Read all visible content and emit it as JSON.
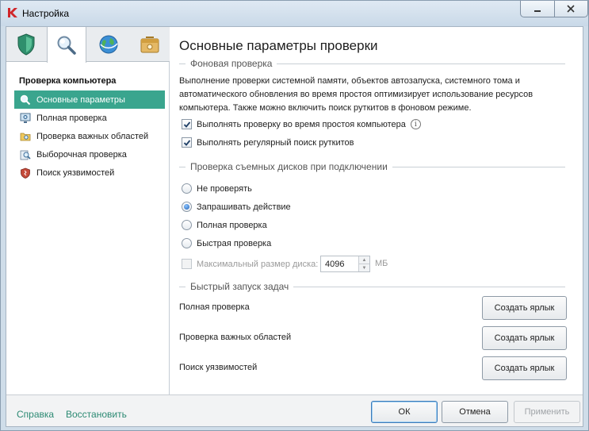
{
  "window": {
    "title": "Настройка",
    "minimize_icon": "minimize-icon",
    "close_icon": "close-icon"
  },
  "tabs": [
    {
      "name": "protection",
      "icon": "shield-icon"
    },
    {
      "name": "scan",
      "icon": "magnifier-icon"
    },
    {
      "name": "update",
      "icon": "globe-icon"
    },
    {
      "name": "advanced",
      "icon": "safe-box-icon"
    }
  ],
  "sidebar": {
    "section_title": "Проверка компьютера",
    "items": [
      {
        "label": "Основные параметры",
        "icon": "magnifier-icon",
        "selected": true
      },
      {
        "label": "Полная проверка",
        "icon": "monitor-scan-icon",
        "selected": false
      },
      {
        "label": "Проверка важных областей",
        "icon": "folder-scan-icon",
        "selected": false
      },
      {
        "label": "Выборочная проверка",
        "icon": "custom-scan-icon",
        "selected": false
      },
      {
        "label": "Поиск уязвимостей",
        "icon": "vulnerability-shield-icon",
        "selected": false
      }
    ]
  },
  "main": {
    "title": "Основные параметры проверки",
    "background_scan": {
      "group_title": "Фоновая проверка",
      "description": "Выполнение проверки системной памяти, объектов автозапуска, системного тома и автоматического обновления во время простоя оптимизирует использование ресурсов компьютера. Также можно включить поиск руткитов в фоновом режиме.",
      "idle_scan_label": "Выполнять проверку во время простоя компьютера",
      "idle_scan_checked": true,
      "rootkit_label": "Выполнять регулярный поиск руткитов",
      "rootkit_checked": true
    },
    "removable": {
      "group_title": "Проверка съемных дисков при подключении",
      "options": [
        {
          "label": "Не проверять",
          "selected": false
        },
        {
          "label": "Запрашивать действие",
          "selected": true
        },
        {
          "label": "Полная проверка",
          "selected": false
        },
        {
          "label": "Быстрая проверка",
          "selected": false
        }
      ],
      "max_size_label": "Максимальный размер диска:",
      "max_size_value": "4096",
      "max_size_unit": "МБ",
      "max_size_enabled": false
    },
    "quick_tasks": {
      "group_title": "Быстрый запуск задач",
      "tasks": [
        {
          "label": "Полная проверка",
          "button": "Создать ярлык"
        },
        {
          "label": "Проверка важных областей",
          "button": "Создать ярлык"
        },
        {
          "label": "Поиск уязвимостей",
          "button": "Создать ярлык"
        }
      ]
    }
  },
  "footer": {
    "help_link": "Справка",
    "restore_link": "Восстановить",
    "ok": "ОК",
    "cancel": "Отмена",
    "apply": "Применить"
  },
  "colors": {
    "accent": "#3aa58e",
    "link": "#2c8a73",
    "logo": "#d0262a"
  }
}
